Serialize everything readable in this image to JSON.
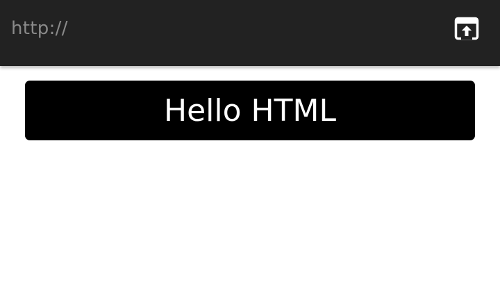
{
  "toolbar": {
    "url_text": "http://",
    "open_icon": "open-in-browser-icon"
  },
  "main": {
    "button_label": "Hello HTML"
  },
  "colors": {
    "toolbar_bg": "#222222",
    "url_text": "#8a8a8a",
    "button_bg": "#000000",
    "button_text": "#ffffff",
    "page_bg": "#ffffff"
  }
}
